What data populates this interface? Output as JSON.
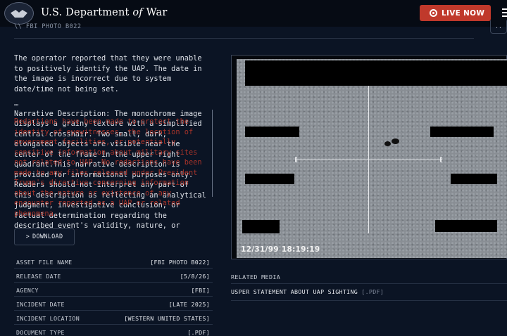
{
  "header": {
    "brand_prefix": "U.S. Department ",
    "brand_of": "of",
    "brand_suffix": " War",
    "live_label": "LIVE NOW"
  },
  "breadcrumb": "\\\\ FBI PHOTO B022",
  "corner_button_label": "..",
  "description": {
    "intro": "The operator reported that they were unable to positively identify the UAP. The date in the image is incorrect due to system date/time not being set.",
    "ellipsis": "…",
    "narrative": "Narrative Description: The monochrome image displays a grainy texture with a simplified central crosshair. Two small, dark, elongated objects are visible near the center of the frame in the upper right quadrant.This narrative description is provided for informational purposes only. Readers should not interpret any part of this description as reflecting an analytical judgment, investigative conclusion, or factual determination regarding the described event's validity, nature, or significance.",
    "redaction_notice": "Redactions have been made to protect the identity of eyewitnesses, the location of government facilities, or potentially sensitive information about military sites not related to UAP. No redactions have been made to any files released under President Trump's directive concerning information about the nature or existence of any encounter reported as a UAP or related phenomena."
  },
  "download": {
    "chevron": ">",
    "label": "DOWNLOAD"
  },
  "metadata": [
    {
      "key": "ASSET FILE NAME",
      "value": "[FBI PHOTO B022]"
    },
    {
      "key": "RELEASE DATE",
      "value": "[5/8/26]"
    },
    {
      "key": "AGENCY",
      "value": "[FBI]"
    },
    {
      "key": "INCIDENT DATE",
      "value": "[LATE 2025]"
    },
    {
      "key": "INCIDENT LOCATION",
      "value": "[WESTERN UNITED STATES]"
    },
    {
      "key": "DOCUMENT TYPE",
      "value": "[.PDF]"
    }
  ],
  "image": {
    "timestamp": "12/31/99 18:19:19"
  },
  "related": {
    "title": "RELATED MEDIA",
    "items": [
      {
        "label": "USPER STATEMENT ABOUT UAP SIGHTING",
        "ext": "[.PDF]"
      }
    ]
  },
  "colors": {
    "background": "#0b1424",
    "header": "#060b14",
    "live_button": "#c0392b",
    "redaction_text": "#c0392b"
  }
}
